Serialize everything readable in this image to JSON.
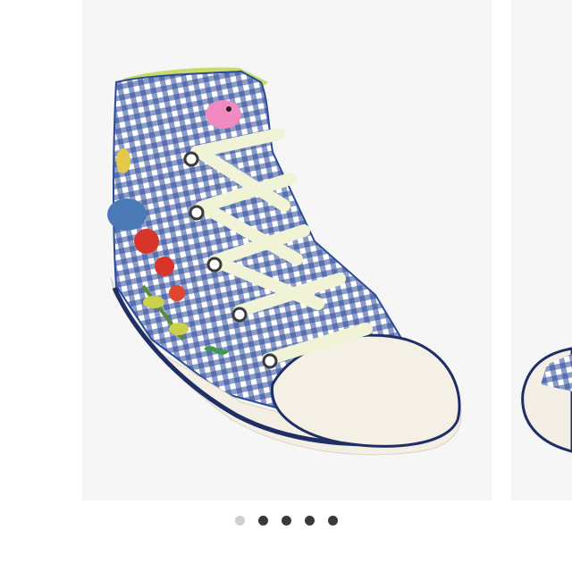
{
  "gallery": {
    "slide_count": 5,
    "active_index": 0,
    "colors": {
      "background": "#ffffff",
      "slide_bg": "#f6f6f6",
      "gingham_blue": "#2c4a9a",
      "sole_cream": "#f3efe4",
      "sole_stripe": "#1f2f66",
      "lining_green": "#c6dc6a",
      "dot_active": "#cfcfcf",
      "dot_inactive": "#3a3a3a"
    }
  }
}
